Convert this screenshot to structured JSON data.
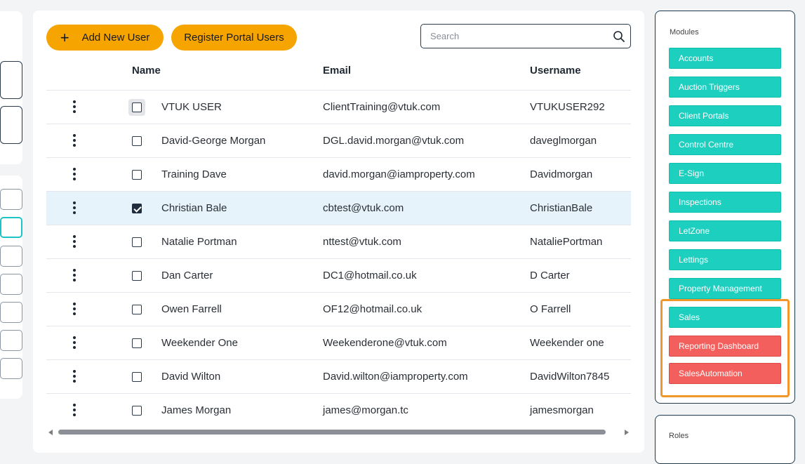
{
  "toolbar": {
    "add_user_label": "Add New User",
    "add_icon": "+",
    "register_portal_label": "Register Portal Users",
    "search_placeholder": "Search"
  },
  "table": {
    "columns": [
      "Name",
      "Email",
      "Username"
    ],
    "rows": [
      {
        "name": "VTUK USER",
        "email": "ClientTraining@vtuk.com",
        "username": "VTUKUSER292",
        "checked": false
      },
      {
        "name": "David-George Morgan",
        "email": "DGL.david.morgan@vtuk.com",
        "username": "daveglmorgan",
        "checked": false
      },
      {
        "name": "Training Dave",
        "email": "david.morgan@iamproperty.com",
        "username": "Davidmorgan",
        "checked": false
      },
      {
        "name": "Christian Bale",
        "email": "cbtest@vtuk.com",
        "username": "ChristianBale",
        "checked": true
      },
      {
        "name": "Natalie Portman",
        "email": "nttest@vtuk.com",
        "username": "NataliePortman",
        "checked": false
      },
      {
        "name": "Dan Carter",
        "email": "DC1@hotmail.co.uk",
        "username": "D Carter",
        "checked": false
      },
      {
        "name": "Owen Farrell",
        "email": "OF12@hotmail.co.uk",
        "username": "O Farrell",
        "checked": false
      },
      {
        "name": "Weekender One",
        "email": "Weekenderone@vtuk.com",
        "username": "Weekender one",
        "checked": false
      },
      {
        "name": "David Wilton",
        "email": "David.wilton@iamproperty.com",
        "username": "DavidWilton7845",
        "checked": false
      },
      {
        "name": "James Morgan",
        "email": "james@morgan.tc",
        "username": "jamesmorgan",
        "checked": false
      }
    ]
  },
  "modules": {
    "title": "Modules",
    "items": [
      {
        "label": "Accounts",
        "state": "enabled"
      },
      {
        "label": "Auction Triggers",
        "state": "enabled"
      },
      {
        "label": "Client Portals",
        "state": "enabled"
      },
      {
        "label": "Control Centre",
        "state": "enabled"
      },
      {
        "label": "E-Sign",
        "state": "enabled"
      },
      {
        "label": "Inspections",
        "state": "enabled"
      },
      {
        "label": "LetZone",
        "state": "enabled"
      },
      {
        "label": "Lettings",
        "state": "enabled"
      },
      {
        "label": "Property Management",
        "state": "enabled"
      },
      {
        "label": "Sales",
        "state": "enabled"
      },
      {
        "label": "Reporting Dashboard",
        "state": "disabled"
      },
      {
        "label": "SalesAutomation",
        "state": "disabled"
      }
    ]
  },
  "roles": {
    "title": "Roles"
  },
  "colors": {
    "accent_orange": "#f5a400",
    "module_enabled": "#1ccfbf",
    "module_disabled": "#f25f5c",
    "highlight": "#f0962a",
    "selected_row": "#e6f3fb"
  },
  "icons": {
    "search": "search-icon",
    "row_menu": "kebab-menu-icon",
    "add": "plus-icon"
  }
}
